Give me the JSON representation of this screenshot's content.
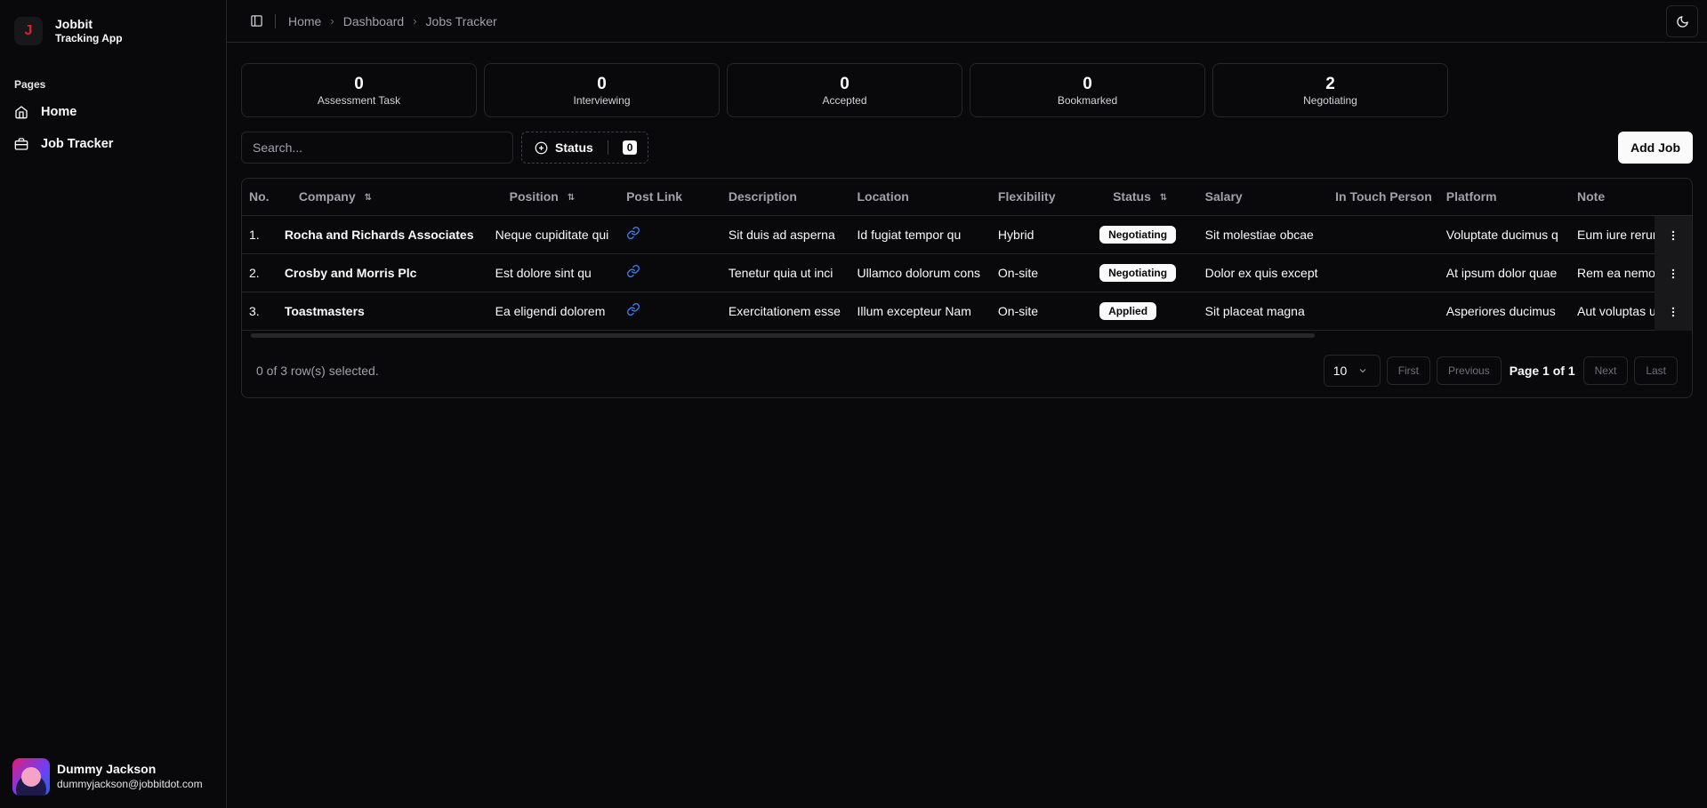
{
  "brand": {
    "initial": "J",
    "name": "Jobbit",
    "subtitle": "Tracking App"
  },
  "sidebar": {
    "section_label": "Pages",
    "items": [
      {
        "label": "Home",
        "icon": "house-icon"
      },
      {
        "label": "Job Tracker",
        "icon": "briefcase-icon"
      }
    ]
  },
  "user": {
    "name": "Dummy Jackson",
    "email": "dummyjackson@jobbitdot.com"
  },
  "breadcrumb": [
    "Home",
    "Dashboard",
    "Jobs Tracker"
  ],
  "stats": [
    {
      "value": "0",
      "label": "Assessment Task"
    },
    {
      "value": "0",
      "label": "Interviewing"
    },
    {
      "value": "0",
      "label": "Accepted"
    },
    {
      "value": "0",
      "label": "Bookmarked"
    },
    {
      "value": "2",
      "label": "Negotiating"
    }
  ],
  "toolbar": {
    "search_placeholder": "Search...",
    "status_label": "Status",
    "status_count": "0",
    "add_job_label": "Add Job"
  },
  "table": {
    "columns": [
      "No.",
      "Company",
      "Position",
      "Post Link",
      "Description",
      "Location",
      "Flexibility",
      "Status",
      "Salary",
      "In Touch Person",
      "Platform",
      "Note"
    ],
    "rows": [
      {
        "no": "1.",
        "company": "Rocha and Richards Associates",
        "position": "Neque cupiditate qui",
        "description": "Sit duis ad asperna",
        "location": "Id fugiat tempor qu",
        "flexibility": "Hybrid",
        "status": "Negotiating",
        "salary": "Sit molestiae obcae",
        "in_touch": "",
        "platform": "Voluptate ducimus q",
        "note": "Eum iure rerum"
      },
      {
        "no": "2.",
        "company": "Crosby and Morris Plc",
        "position": "Est dolore sint qu",
        "description": "Tenetur quia ut inci",
        "location": "Ullamco dolorum cons",
        "flexibility": "On-site",
        "status": "Negotiating",
        "salary": "Dolor ex quis except",
        "in_touch": "",
        "platform": "At ipsum dolor quae",
        "note": "Rem ea nemo d"
      },
      {
        "no": "3.",
        "company": "Toastmasters",
        "position": "Ea eligendi dolorem",
        "description": "Exercitationem esse",
        "location": "Illum excepteur Nam",
        "flexibility": "On-site",
        "status": "Applied",
        "salary": "Sit placeat magna",
        "in_touch": "",
        "platform": "Asperiores ducimus",
        "note": "Aut voluptas u"
      }
    ]
  },
  "footer": {
    "selected_text": "0 of 3 row(s) selected.",
    "page_size": "10",
    "first": "First",
    "previous": "Previous",
    "page_info": "Page 1 of 1",
    "next": "Next",
    "last": "Last"
  },
  "colors": {
    "background": "#09090b",
    "border": "#27272a",
    "link": "#3b82f6",
    "brand_accent": "#e11d2e"
  }
}
